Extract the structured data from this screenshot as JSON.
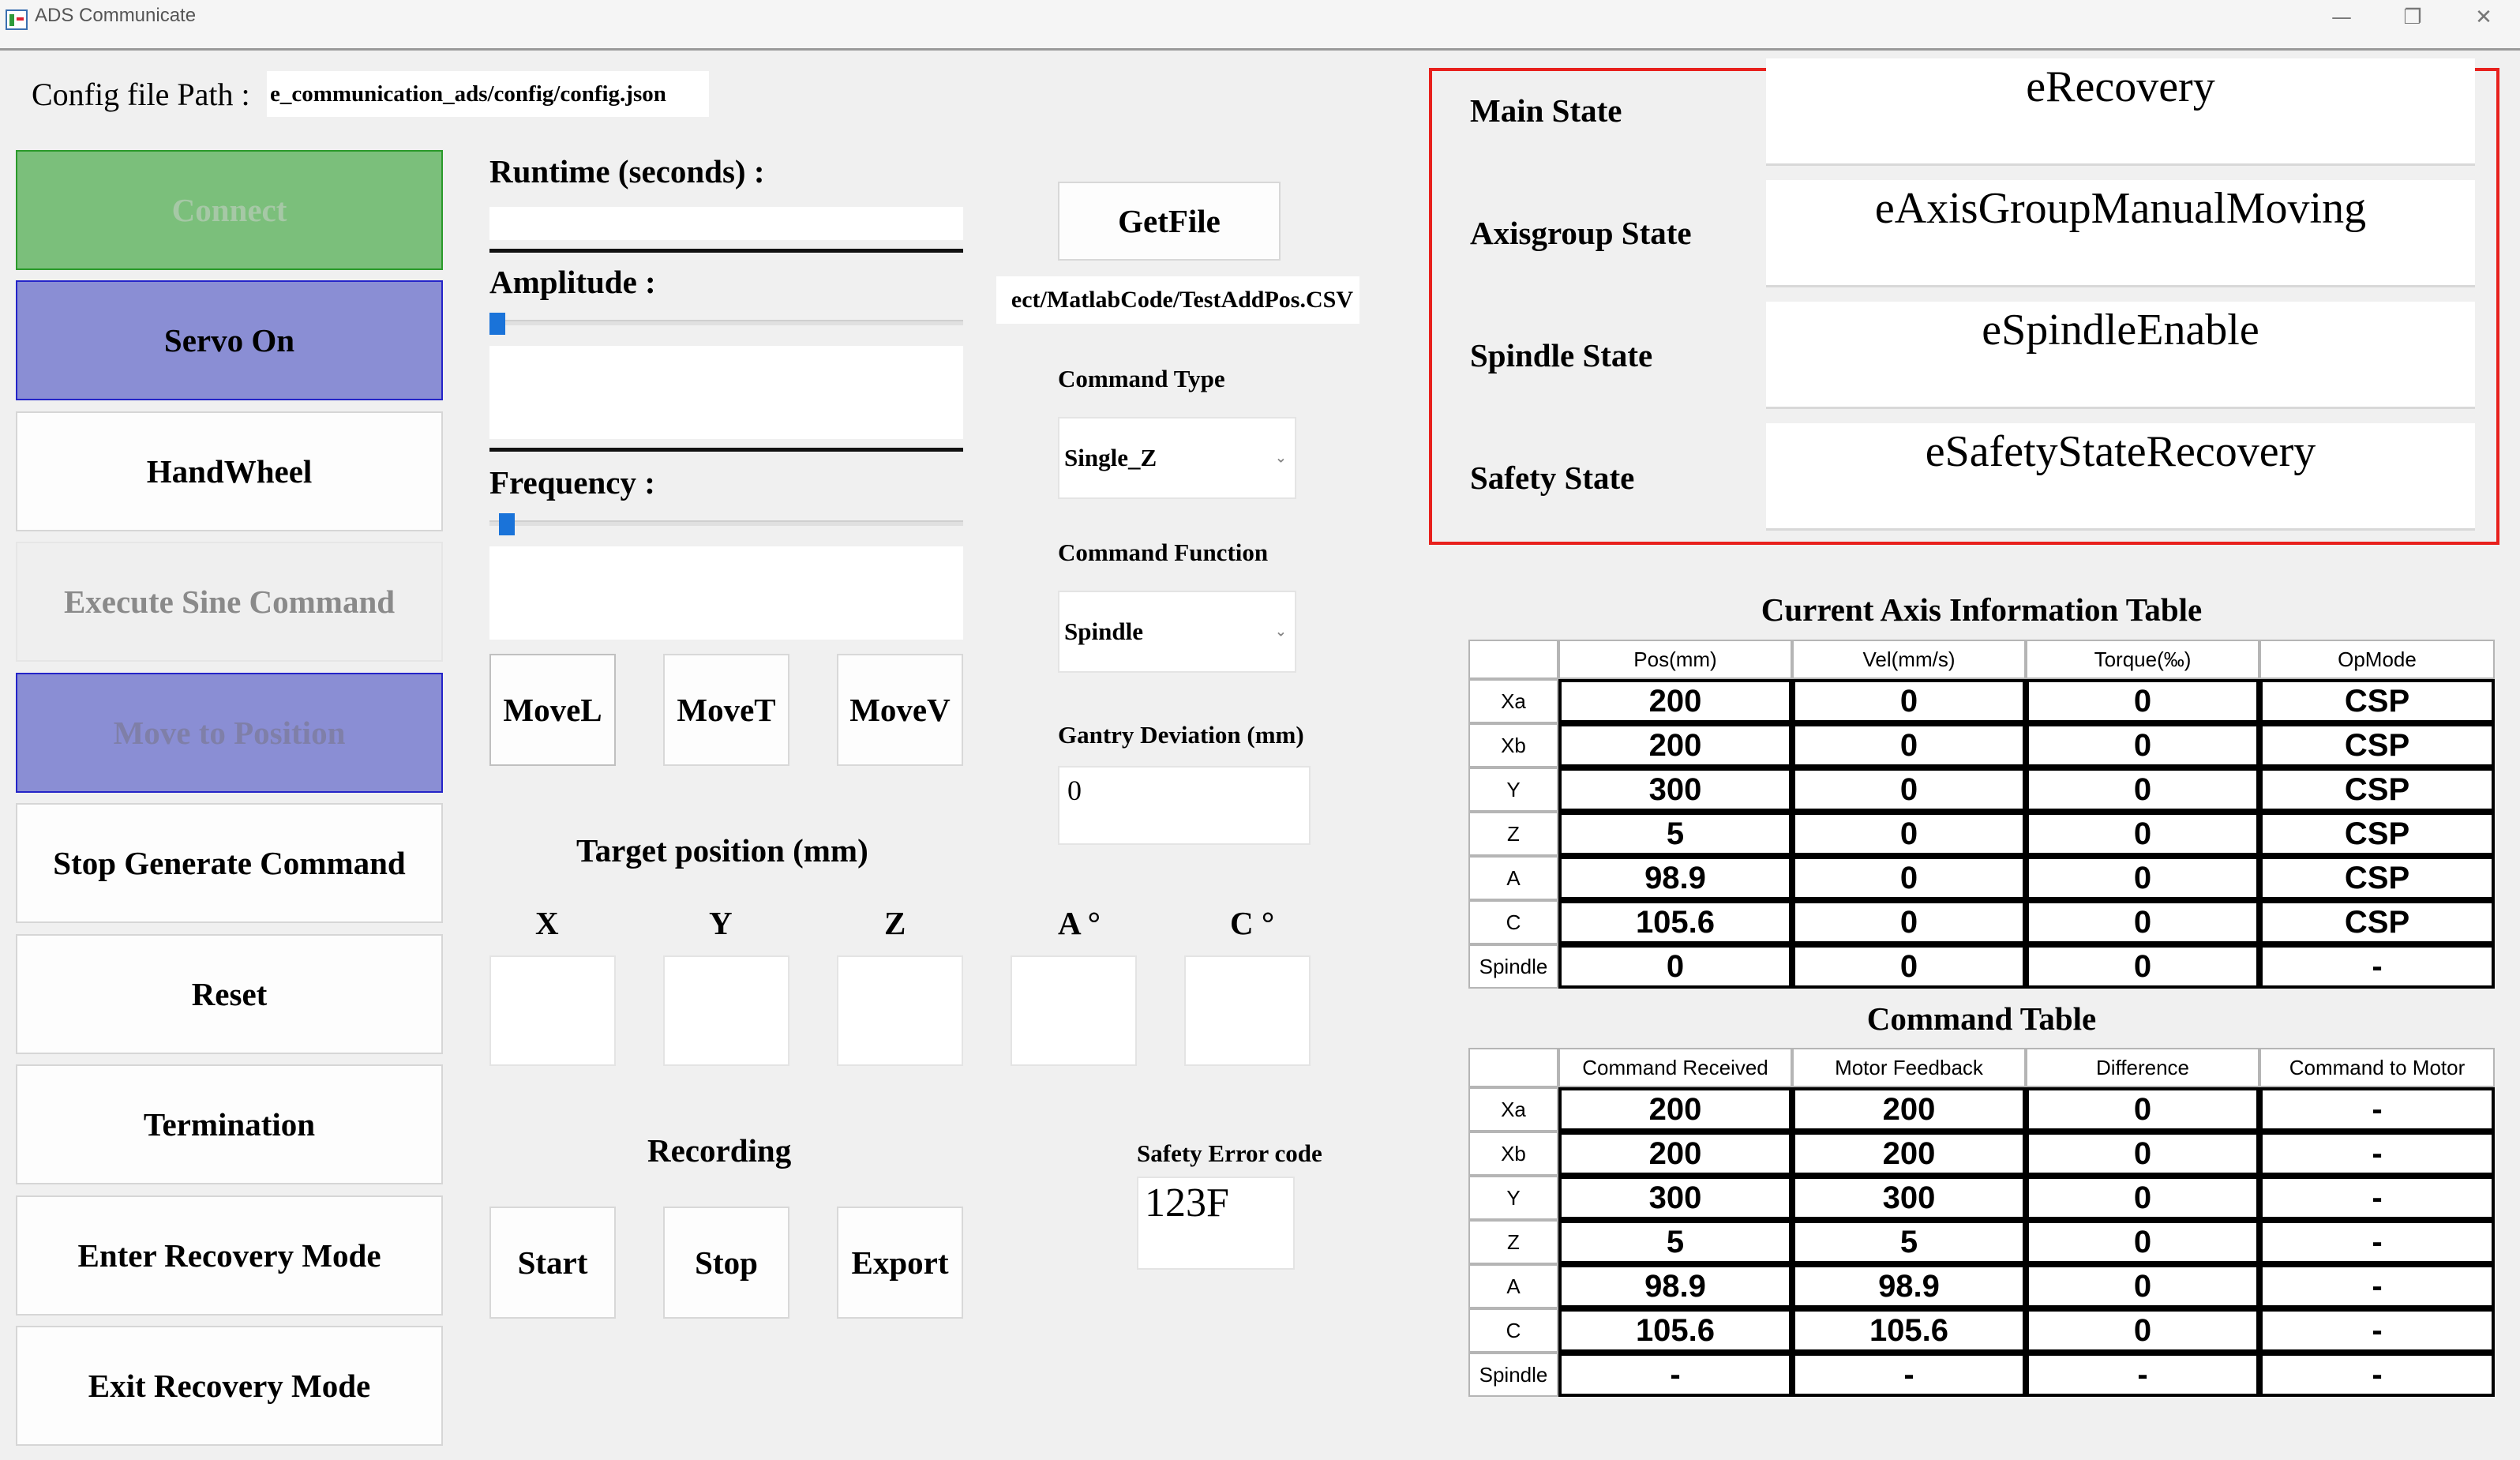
{
  "window": {
    "title": "ADS Communicate",
    "minimize": "—",
    "restore": "❐",
    "close": "✕"
  },
  "config": {
    "label": "Config file Path :",
    "path": "e_communication_ads/config/config.json"
  },
  "left_buttons": {
    "connect": "Connect",
    "servo_on": "Servo On",
    "handwheel": "HandWheel",
    "execute_sine": "Execute Sine Command",
    "move_to_position": "Move to Position",
    "stop_generate": "Stop Generate Command",
    "reset": "Reset",
    "termination": "Termination",
    "enter_recovery": "Enter Recovery Mode",
    "exit_recovery": "Exit Recovery Mode"
  },
  "sine": {
    "runtime_label": "Runtime (seconds) :",
    "runtime_value": "",
    "amplitude_label": "Amplitude :",
    "amplitude_value": "",
    "frequency_label": "Frequency :",
    "frequency_value": ""
  },
  "move_buttons": {
    "movel": "MoveL",
    "movet": "MoveT",
    "movev": "MoveV"
  },
  "target": {
    "title": "Target position (mm)",
    "axes": [
      "X",
      "Y",
      "Z",
      "A °",
      "C °"
    ]
  },
  "recording": {
    "title": "Recording",
    "start": "Start",
    "stop": "Stop",
    "export": "Export"
  },
  "file": {
    "getfile": "GetFile",
    "path": "ect/MatlabCode/TestAddPos.CSV"
  },
  "command": {
    "type_label": "Command Type",
    "type_value": "Single_Z",
    "function_label": "Command Function",
    "function_value": "Spindle",
    "gantry_label": "Gantry Deviation (mm)",
    "gantry_value": "0",
    "safety_label": "Safety Error code",
    "safety_value": "123F"
  },
  "states": [
    {
      "label": "Main State",
      "value": "eRecovery"
    },
    {
      "label": "Axisgroup State",
      "value": "eAxisGroupManualMoving"
    },
    {
      "label": "Spindle State",
      "value": "eSpindleEnable"
    },
    {
      "label": "Safety State",
      "value": "eSafetyStateRecovery"
    }
  ],
  "axis_table": {
    "title": "Current Axis Information Table",
    "columns": [
      "Pos(mm)",
      "Vel(mm/s)",
      "Torque(‰)",
      "OpMode"
    ],
    "rows": [
      {
        "name": "Xa",
        "cells": [
          "200",
          "0",
          "0",
          "CSP"
        ]
      },
      {
        "name": "Xb",
        "cells": [
          "200",
          "0",
          "0",
          "CSP"
        ]
      },
      {
        "name": "Y",
        "cells": [
          "300",
          "0",
          "0",
          "CSP"
        ]
      },
      {
        "name": "Z",
        "cells": [
          "5",
          "0",
          "0",
          "CSP"
        ]
      },
      {
        "name": "A",
        "cells": [
          "98.9",
          "0",
          "0",
          "CSP"
        ]
      },
      {
        "name": "C",
        "cells": [
          "105.6",
          "0",
          "0",
          "CSP"
        ]
      },
      {
        "name": "Spindle",
        "cells": [
          "0",
          "0",
          "0",
          "-"
        ]
      }
    ]
  },
  "command_table": {
    "title": "Command Table",
    "columns": [
      "Command Received",
      "Motor Feedback",
      "Difference",
      "Command to Motor"
    ],
    "rows": [
      {
        "name": "Xa",
        "cells": [
          "200",
          "200",
          "0",
          "-"
        ]
      },
      {
        "name": "Xb",
        "cells": [
          "200",
          "200",
          "0",
          "-"
        ]
      },
      {
        "name": "Y",
        "cells": [
          "300",
          "300",
          "0",
          "-"
        ]
      },
      {
        "name": "Z",
        "cells": [
          "5",
          "5",
          "0",
          "-"
        ]
      },
      {
        "name": "A",
        "cells": [
          "98.9",
          "98.9",
          "0",
          "-"
        ]
      },
      {
        "name": "C",
        "cells": [
          "105.6",
          "105.6",
          "0",
          "-"
        ]
      },
      {
        "name": "Spindle",
        "cells": [
          "-",
          "-",
          "-",
          "-"
        ]
      }
    ]
  }
}
